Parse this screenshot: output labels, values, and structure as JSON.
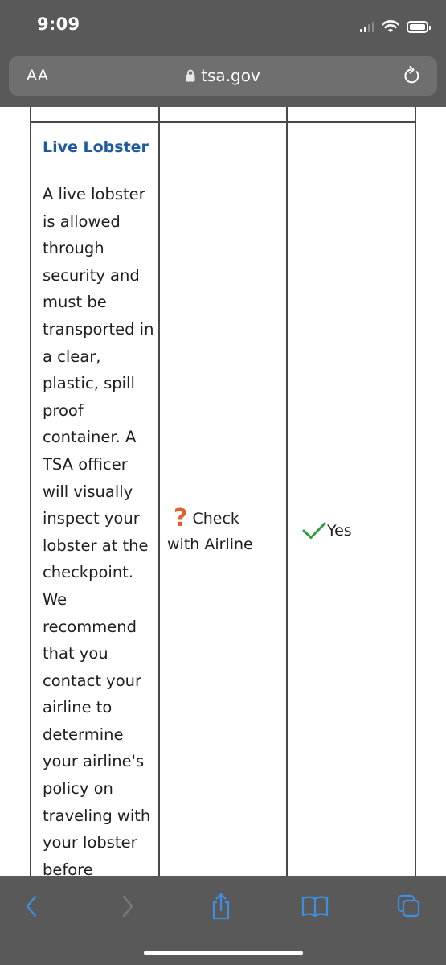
{
  "status_bar": {
    "time": "9:09",
    "icons": [
      "cellular-signal-icon",
      "wifi-icon",
      "battery-icon"
    ]
  },
  "address_bar": {
    "text_size_label": "AA",
    "url": "tsa.gov",
    "icons": [
      "lock-icon",
      "reload-icon"
    ]
  },
  "table": {
    "item_title": "Live Lobster",
    "item_description": "A live lobster is allowed through security and must be transported in a clear, plastic, spill proof container. A TSA officer will visually inspect your lobster at the checkpoint. We recommend that you contact your airline to determine your airline's policy on traveling with your lobster before",
    "carry_on": {
      "icon": "question-mark-icon",
      "label": "Check with Airline"
    },
    "checked": {
      "icon": "checkmark-icon",
      "label": "Yes"
    }
  },
  "toolbar": {
    "buttons": [
      "back-icon",
      "forward-icon",
      "share-icon",
      "bookmarks-icon",
      "tabs-icon"
    ]
  },
  "colors": {
    "chrome": "#595959",
    "url_field": "#6f6f6f",
    "title_blue": "#1f5a9e",
    "question_orange": "#e25e2a",
    "check_green": "#2f9e3a",
    "toolbar_blue": "#3d8fe0"
  }
}
